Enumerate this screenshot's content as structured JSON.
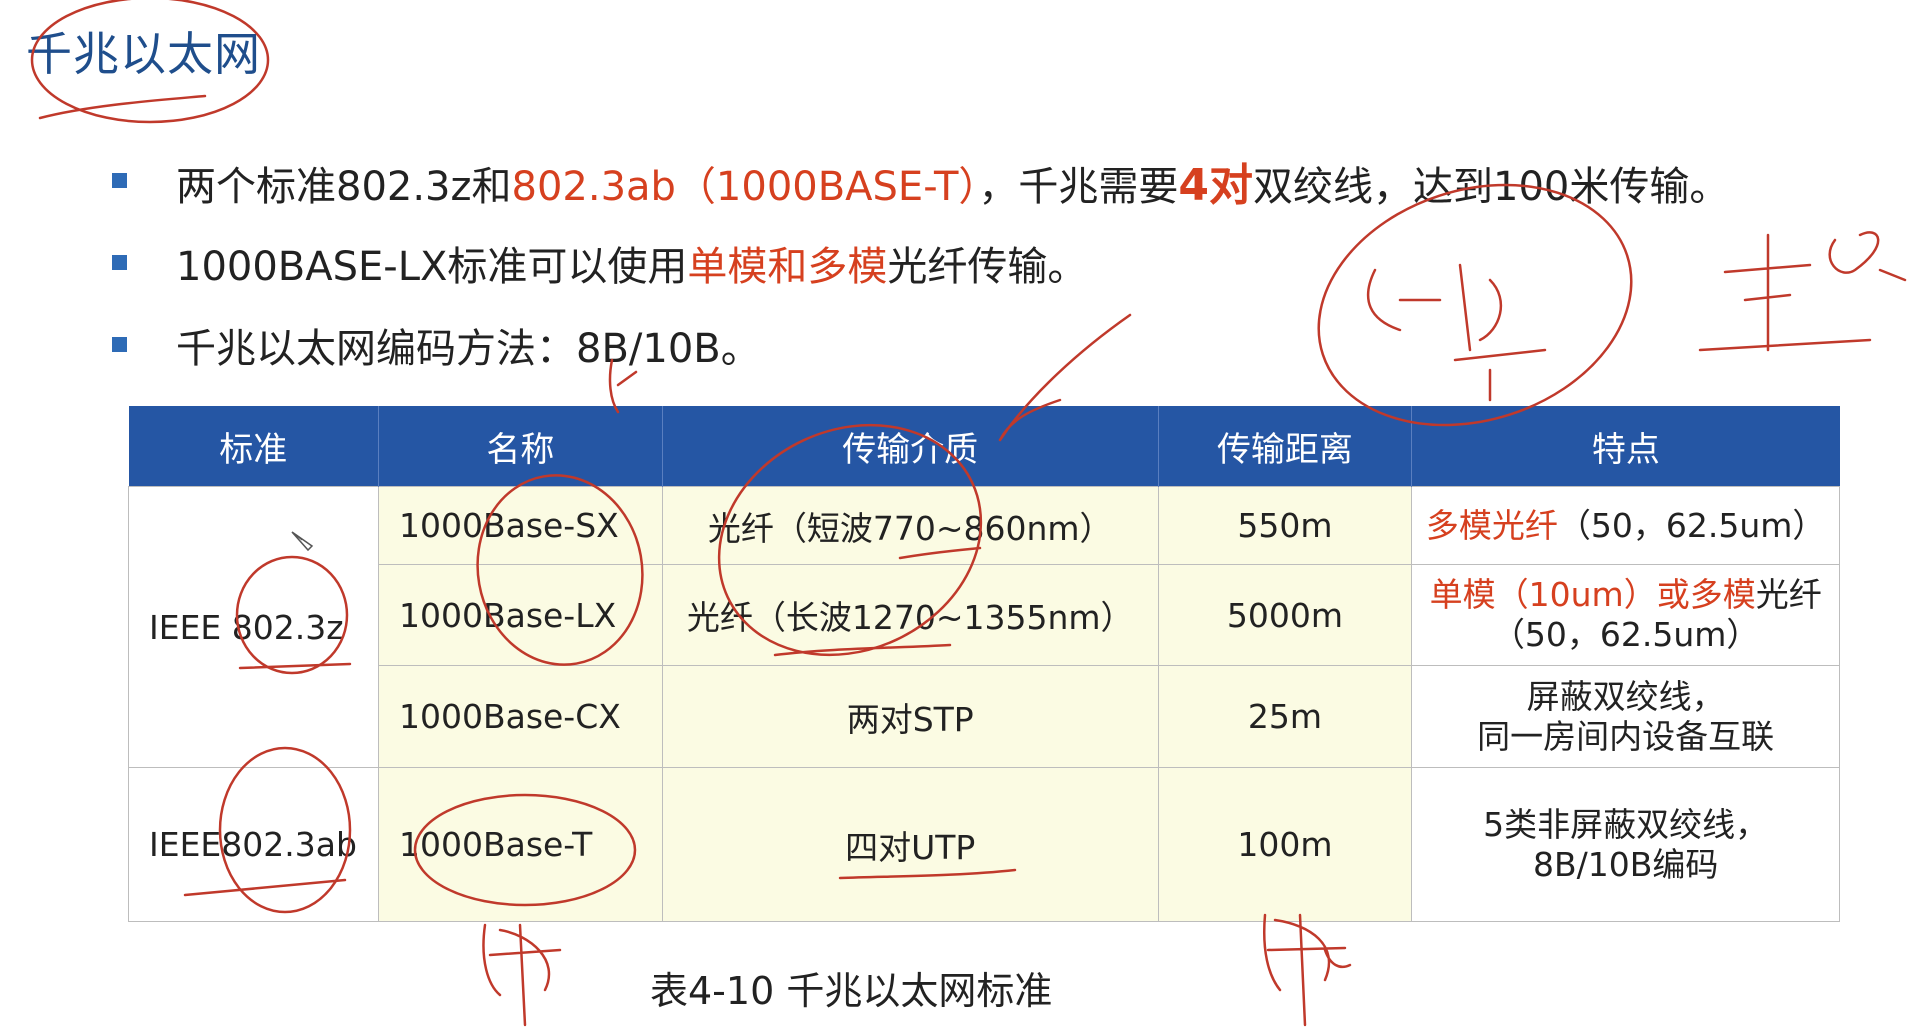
{
  "title": "千兆以太网",
  "bullets": [
    {
      "parts": [
        {
          "text": "两个标准802.3z和",
          "red": false
        },
        {
          "text": "802.3ab（1000BASE-T）",
          "red": true
        },
        {
          "text": "，千兆需要",
          "red": false
        },
        {
          "text": "4对",
          "red": true
        },
        {
          "text": "双绞线，达到100米传输。",
          "red": false
        }
      ]
    },
    {
      "parts": [
        {
          "text": "1000BASE-LX标准可以使用",
          "red": false
        },
        {
          "text": "单模和多模",
          "red": true
        },
        {
          "text": "光纤传输。",
          "red": false
        }
      ]
    },
    {
      "parts": [
        {
          "text": "千兆以太网编码方法：8B/10B。",
          "red": false
        }
      ]
    }
  ],
  "table": {
    "headers": [
      "标准",
      "名称",
      "传输介质",
      "传输距离",
      "特点"
    ],
    "standards": [
      "IEEE 802.3z",
      "IEEE802.3ab"
    ],
    "rows": [
      {
        "name": "1000Base-SX",
        "medium": "光纤（短波770~860nm）",
        "distance": "550m",
        "feature_red": "多模光纤",
        "feature_rest": "（50，62.5um）",
        "feature_line2": ""
      },
      {
        "name": "1000Base-LX",
        "medium": "光纤（长波1270~1355nm）",
        "distance": "5000m",
        "feature_red": "单模（10um）或多模",
        "feature_rest": "光纤",
        "feature_line2": "（50，62.5um）"
      },
      {
        "name": "1000Base-CX",
        "medium": "两对STP",
        "distance": "25m",
        "feature_red": "",
        "feature_rest": "屏蔽双绞线，",
        "feature_line2": "同一房间内设备互联"
      },
      {
        "name": "1000Base-T",
        "medium": "四对UTP",
        "distance": "100m",
        "feature_red": "",
        "feature_rest": "5类非屏蔽双绞线，",
        "feature_line2": "8B/10B编码"
      }
    ]
  },
  "caption": "表4-10 千兆以太网标准",
  "colors": {
    "title": "#1f4e8c",
    "header_bg": "#2556a4",
    "accent_red": "#d6401f",
    "cell_yellow": "#fbfbe3",
    "ink": "#c0392b"
  }
}
